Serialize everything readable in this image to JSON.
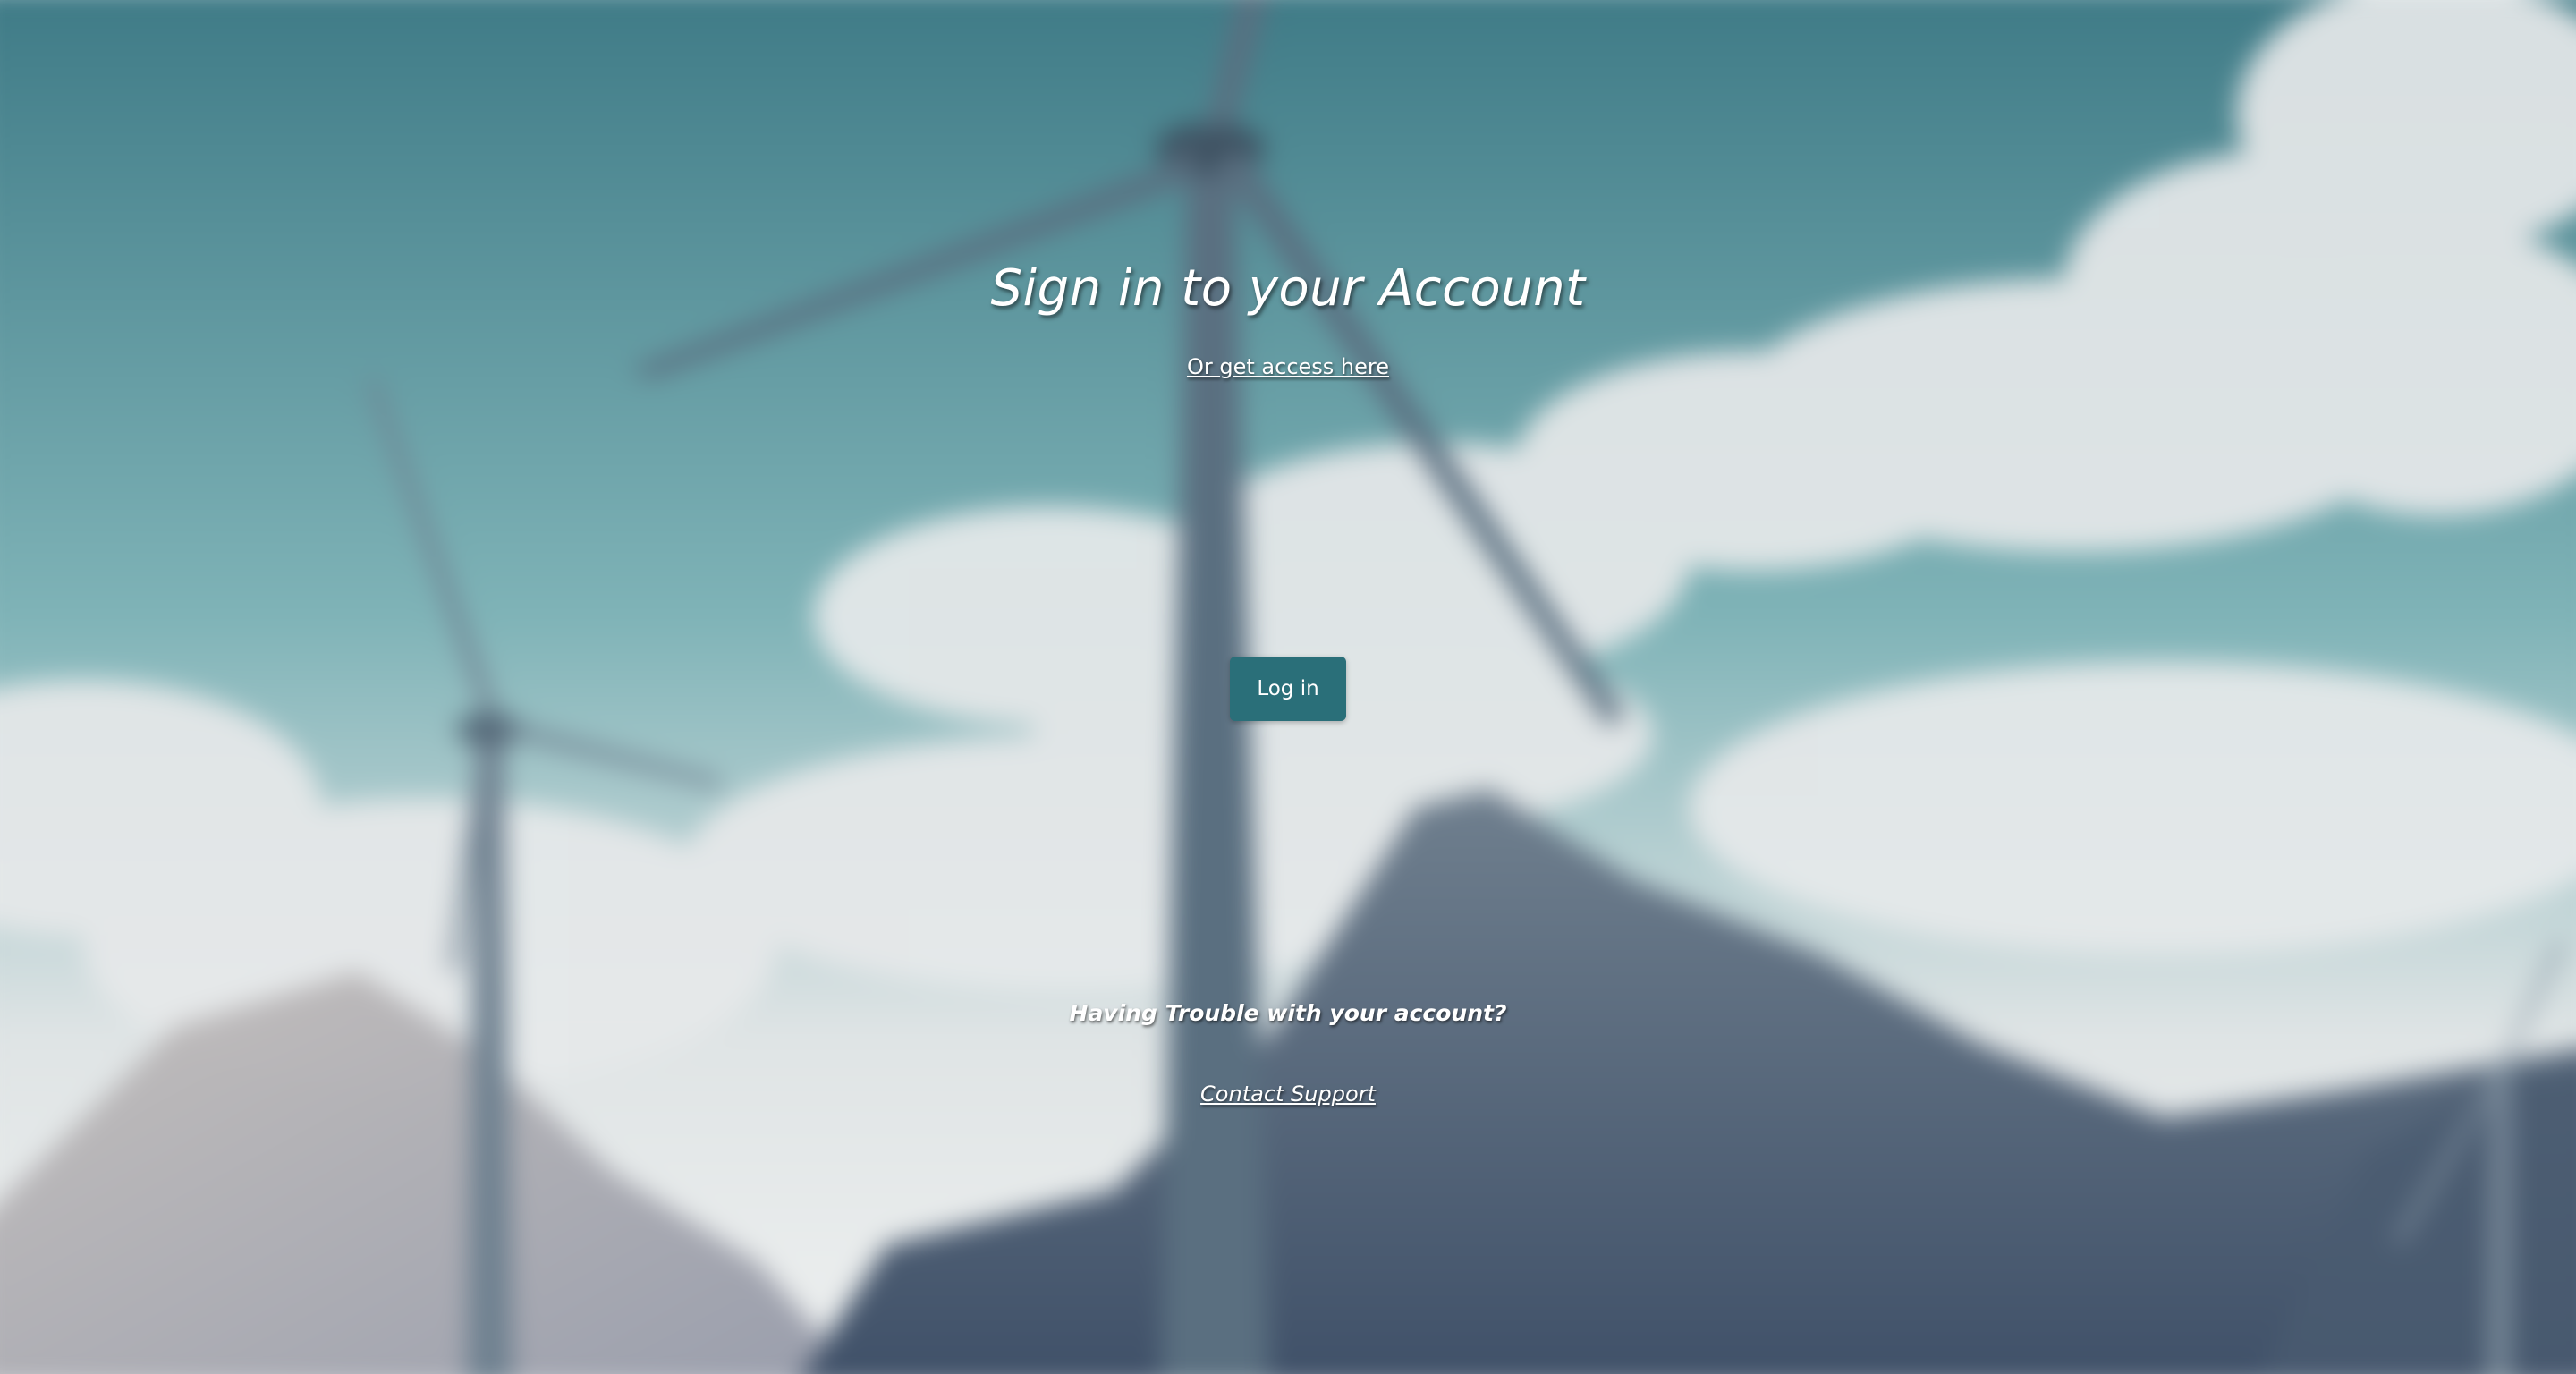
{
  "page": {
    "title": "Sign in to your Account",
    "access_link": "Or get access here",
    "login_button": "Log in",
    "trouble_text": "Having Trouble with your account?",
    "support_link": "Contact Support"
  },
  "colors": {
    "button_bg": "#2a6f79",
    "text": "#ffffff",
    "sky_top": "#3e7a86",
    "sky_mid": "#7fb3b7",
    "cloud": "#e6e9ea",
    "mountain": "#4c5e72"
  },
  "background": {
    "description_icon": "wind-turbines-mountains-background"
  }
}
